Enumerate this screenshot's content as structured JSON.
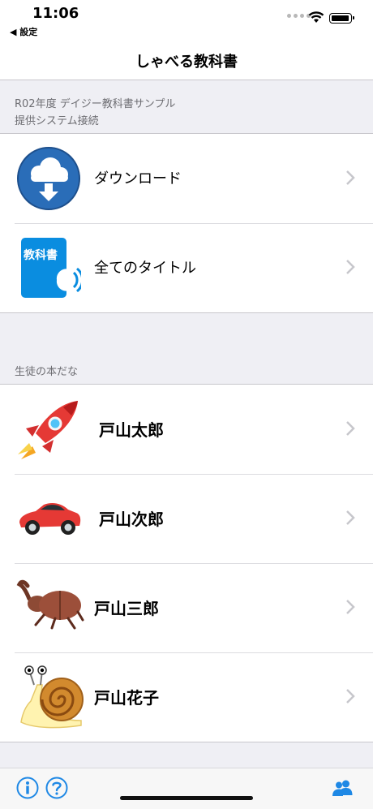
{
  "status": {
    "time": "11:06",
    "back_label": "◀ 設定"
  },
  "nav": {
    "title": "しゃべる教科書"
  },
  "section1": {
    "header_line1": "R02年度 デイジー教科書サンプル",
    "header_line2": "提供システム接続",
    "items": [
      {
        "label": "ダウンロード",
        "icon": "download-cloud-icon"
      },
      {
        "label": "全てのタイトル",
        "icon": "textbook-icon",
        "icon_text": "教科書"
      }
    ]
  },
  "section2": {
    "header": "生徒の本だな",
    "students": [
      {
        "name": "戸山太郎",
        "icon": "rocket-icon"
      },
      {
        "name": "戸山次郎",
        "icon": "car-icon"
      },
      {
        "name": "戸山三郎",
        "icon": "beetle-icon"
      },
      {
        "name": "戸山花子",
        "icon": "snail-icon"
      }
    ]
  },
  "toolbar": {
    "left_icons": [
      "info-icon",
      "help-icon"
    ],
    "right_icon": "users-icon"
  },
  "colors": {
    "accent": "#1e88e5",
    "chevron": "#c7c7cc",
    "background": "#efeff4"
  }
}
